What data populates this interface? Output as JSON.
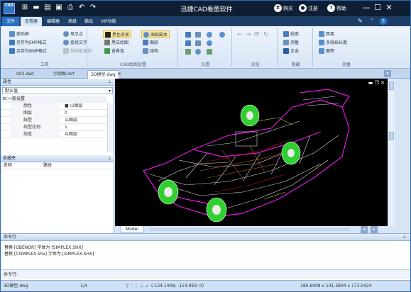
{
  "app": {
    "logo_text": "CAD",
    "title": "迅捷CAD看图软件"
  },
  "titlebar_actions": [
    {
      "label": "购买",
      "icon": "cart-icon"
    },
    {
      "label": "注册",
      "icon": "user-icon"
    },
    {
      "label": "帮助",
      "icon": "help-icon"
    }
  ],
  "menu_tabs": [
    "文件",
    "查看器",
    "编辑器",
    "高级",
    "输出",
    "VIP功能"
  ],
  "ribbon": {
    "tools": {
      "label": "工具",
      "items": [
        "另存为EMF格式",
        "另存为BMP格式",
        "显示点",
        "查找文字",
        "剪裁为框",
        "剪贴板复制"
      ]
    },
    "tools_top": "剪贴框",
    "cad_settings": {
      "label": "CAD绘图设置",
      "items": [
        "黑色背景",
        "黑白绘图",
        "背景色",
        "图纸副本",
        "图层",
        "结构"
      ]
    },
    "position": {
      "label": "位置"
    },
    "browse": {
      "label": "浏览"
    },
    "hidden": {
      "label": "隐藏",
      "items": [
        "线宽",
        "测量",
        "文本"
      ]
    },
    "measure": {
      "label": "测量",
      "items": [
        "距离",
        "多段线长度",
        "面积"
      ]
    }
  },
  "doc_tabs": [
    "003.dwt",
    "示例图.dxf",
    "3D模型.dwg"
  ],
  "properties_panel": {
    "title": "属性",
    "dropdown": "默认值",
    "section": "一般设置",
    "rows": [
      {
        "key": "颜色",
        "value": "■ 以图层"
      },
      {
        "key": "图层",
        "value": "0"
      },
      {
        "key": "线型",
        "value": "以图层"
      },
      {
        "key": "线型比例",
        "value": "1"
      },
      {
        "key": "线宽",
        "value": "以图层"
      }
    ]
  },
  "favorites_panel": {
    "title": "收藏夹",
    "columns": [
      "名称",
      "路径"
    ]
  },
  "model_tab": "Model",
  "command": {
    "title": "命令行",
    "log": [
      "替换 [GBENOR] 字体为 [SIMPLEX.SHX]",
      "替换 [COMPLEX.shx] 字体为 [SIMPLEX.SHX]"
    ],
    "prompt": "命令行:"
  },
  "status": {
    "file": "3D模型.dwg",
    "page": "1/4",
    "coords": "(-124.1448; -114.993; 0)",
    "size": "180.6008 x 141.5804 x 173.0424"
  },
  "colors": {
    "titlebar": "#0f1f33",
    "menubar": "#1d3e66",
    "wheel": "#2fd02f",
    "frame_magenta": "#e01adf",
    "frame_white": "#ffffff",
    "canvas_bg": "#000000"
  }
}
